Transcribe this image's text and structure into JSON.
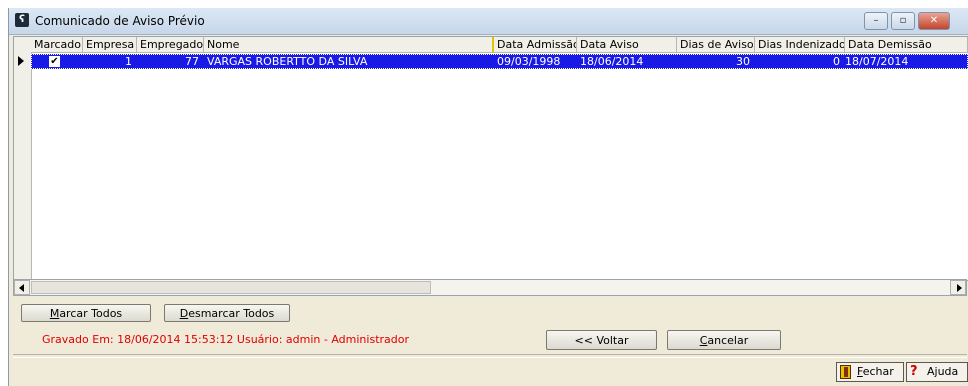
{
  "window": {
    "title": "Comunicado de Aviso Prévio",
    "controls": {
      "minimize": "–",
      "maximize": "▫",
      "close": "✕"
    }
  },
  "grid": {
    "columns": [
      "Marcado",
      "Empresa",
      "Empregado",
      "Nome",
      "Data Admissão",
      "Data Aviso",
      "Dias de Aviso",
      "Dias Indenizado",
      "Data Demissão"
    ],
    "rows": [
      {
        "marcado": true,
        "empresa": "1",
        "empregado": "77",
        "nome": "VARGAS ROBERTTO DA SILVA",
        "data_admissao": "09/03/1998",
        "data_aviso": "18/06/2014",
        "dias_aviso": "30",
        "dias_indenizado": "0",
        "data_demissao": "18/07/2014"
      }
    ]
  },
  "buttons": {
    "marcar_todos": {
      "accel": "M",
      "rest": "arcar Todos"
    },
    "desmarcar_todos": {
      "accel": "D",
      "rest": "esmarcar Todos"
    },
    "voltar": "<< Voltar",
    "cancelar": {
      "accel": "C",
      "rest": "ancelar"
    },
    "fechar": {
      "accel": "F",
      "rest": "echar"
    },
    "ajuda": "Ajuda"
  },
  "status": "Gravado Em: 18/06/2014 15:53:12 Usuário: admin - Administrador",
  "icons": {
    "app": "app-icon",
    "row_indicator": "row-indicator-arrow-icon",
    "checkbox": "checkmark-icon",
    "fechar": "door-exit-icon",
    "ajuda": "question-mark-icon"
  },
  "colors": {
    "selection": "#1a1ae6",
    "status_text": "#e00000",
    "column_highlight": "#e3c400"
  }
}
